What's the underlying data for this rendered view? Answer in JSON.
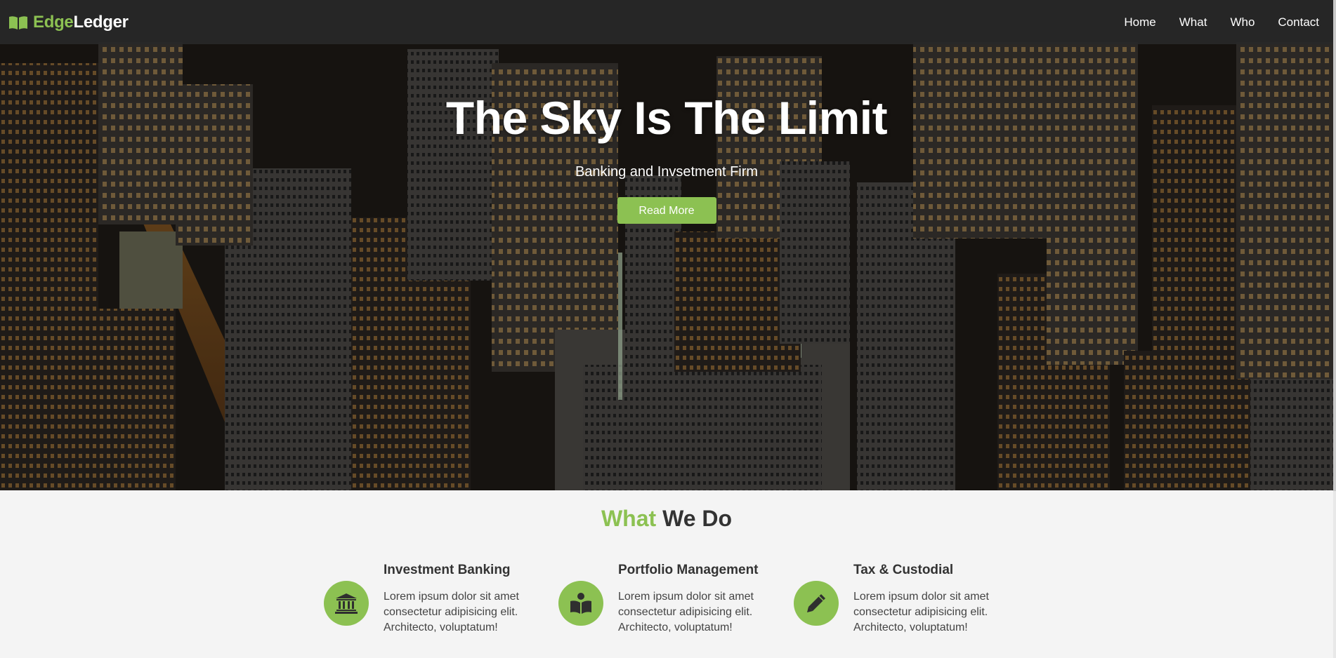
{
  "brand": {
    "name_part1": "Edge",
    "name_part2": "Ledger",
    "icon": "open-book-icon",
    "accent_color": "#8cc152"
  },
  "nav": {
    "items": [
      {
        "label": "Home"
      },
      {
        "label": "What"
      },
      {
        "label": "Who"
      },
      {
        "label": "Contact"
      }
    ]
  },
  "hero": {
    "title": "The Sky Is The Limit",
    "subtitle": "Banking and Invsetment Firm",
    "button_label": "Read More"
  },
  "services_section": {
    "title_accent": "What",
    "title_rest": "We Do",
    "items": [
      {
        "icon": "bank-icon",
        "heading": "Investment Banking",
        "lines": [
          "Lorem ipsum dolor sit amet",
          "consectetur adipisicing elit.",
          "Architecto, voluptatum!"
        ]
      },
      {
        "icon": "reading-person-icon",
        "heading": "Portfolio Management",
        "lines": [
          "Lorem ipsum dolor sit amet",
          "consectetur adipisicing elit.",
          "Architecto, voluptatum!"
        ]
      },
      {
        "icon": "pencil-icon",
        "heading": "Tax & Custodial",
        "lines": [
          "Lorem ipsum dolor sit amet",
          "consectetur adipisicing elit.",
          "Architecto, voluptatum!"
        ]
      }
    ]
  }
}
